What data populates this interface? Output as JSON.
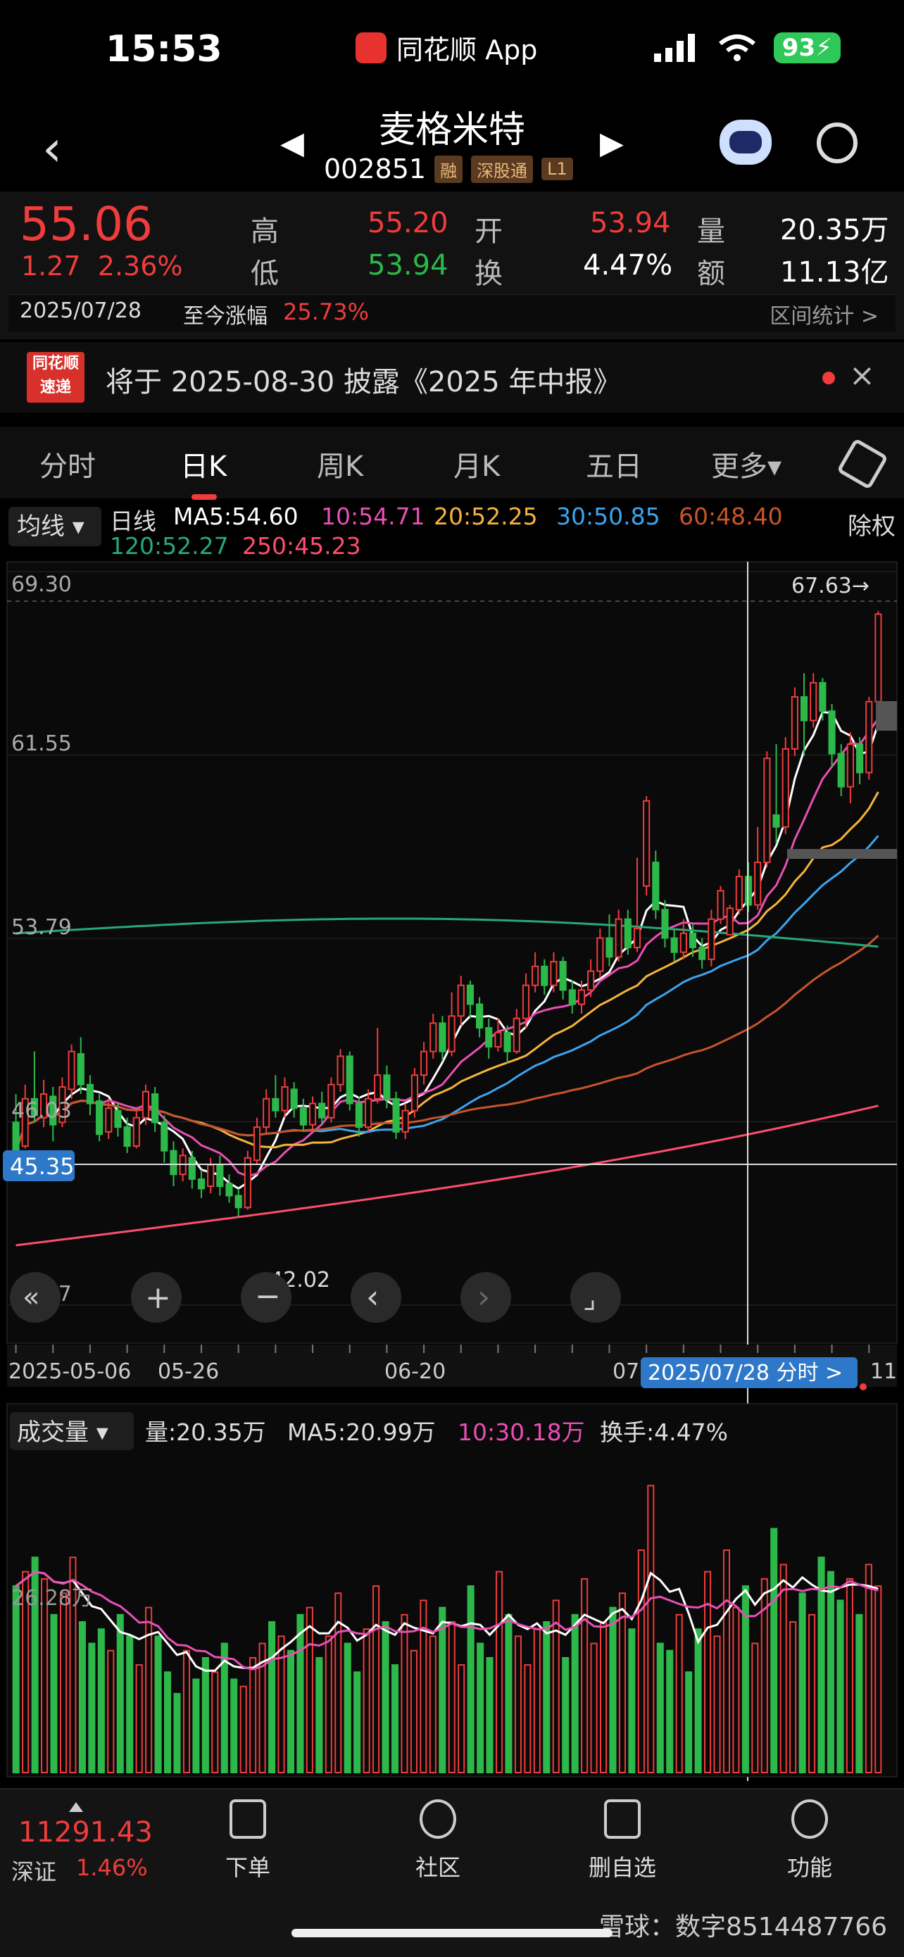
{
  "status": {
    "time": "15:53",
    "app_name": "同花顺 App",
    "battery": "93"
  },
  "header": {
    "title": "麦格米特",
    "code": "002851",
    "tags": [
      "融",
      "深股通",
      "L1"
    ]
  },
  "quote": {
    "price": "55.06",
    "change_abs": "1.27",
    "change_pct": "2.36%",
    "high_label": "高",
    "high": "55.20",
    "open_label": "开",
    "open": "53.94",
    "volume_label": "量",
    "volume": "20.35万",
    "low_label": "低",
    "low": "53.94",
    "turnover_label": "换",
    "turnover": "4.47%",
    "amount_label": "额",
    "amount": "11.13亿",
    "date": "2025/07/28",
    "to_now_label": "至今涨幅",
    "to_now_value": "25.73%",
    "range_stats": "区间统计 >"
  },
  "news": {
    "badge_top": "同花顺",
    "badge_bottom": "速递",
    "text": "将于 2025-08-30 披露《2025 年中报》"
  },
  "tabs": [
    "分时",
    "日K",
    "周K",
    "月K",
    "五日",
    "更多▾"
  ],
  "ma_legend": {
    "select": "均线 ▾",
    "series_label": "日线",
    "ma5": "MA5:54.60",
    "ma10": "10:54.71",
    "ma20": "20:52.25",
    "ma30": "30:50.85",
    "ma60": "60:48.40",
    "ma120": "120:52.27",
    "ma250": "250:45.23",
    "fuquan": "除权"
  },
  "chart_data": {
    "type": "candlestick",
    "y_labels": [
      "69.30",
      "61.55",
      "53.79",
      "46.03",
      "38.27"
    ],
    "ylim": [
      38.27,
      69.3
    ],
    "cursor_price": "45.35",
    "max_marker": "67.63→",
    "min_marker": "←42.02",
    "x_labels": [
      "2025-05-06",
      "05-26",
      "06-20",
      "07",
      "11"
    ],
    "cursor_date": "2025/07/28 分时 >",
    "candles": [
      {
        "o": 46.0,
        "c": 44.8,
        "h": 47.2,
        "l": 44.6
      },
      {
        "o": 45.0,
        "c": 47.0,
        "h": 47.6,
        "l": 44.9
      },
      {
        "o": 47.0,
        "c": 46.3,
        "h": 49.0,
        "l": 46.0
      },
      {
        "o": 46.2,
        "c": 47.2,
        "h": 47.8,
        "l": 45.8
      },
      {
        "o": 47.1,
        "c": 45.9,
        "h": 47.5,
        "l": 45.2
      },
      {
        "o": 46.0,
        "c": 47.5,
        "h": 47.9,
        "l": 45.8
      },
      {
        "o": 47.4,
        "c": 49.0,
        "h": 49.3,
        "l": 47.0
      },
      {
        "o": 48.9,
        "c": 47.6,
        "h": 49.6,
        "l": 47.2
      },
      {
        "o": 47.6,
        "c": 46.8,
        "h": 48.0,
        "l": 46.3
      },
      {
        "o": 46.9,
        "c": 45.5,
        "h": 47.2,
        "l": 45.2
      },
      {
        "o": 45.6,
        "c": 46.6,
        "h": 47.0,
        "l": 45.3
      },
      {
        "o": 46.5,
        "c": 45.8,
        "h": 46.8,
        "l": 45.4
      },
      {
        "o": 45.8,
        "c": 45.0,
        "h": 46.2,
        "l": 44.7
      },
      {
        "o": 45.0,
        "c": 46.2,
        "h": 46.5,
        "l": 44.9
      },
      {
        "o": 46.2,
        "c": 47.3,
        "h": 47.6,
        "l": 45.9
      },
      {
        "o": 47.2,
        "c": 46.0,
        "h": 47.5,
        "l": 45.6
      },
      {
        "o": 46.0,
        "c": 44.8,
        "h": 46.3,
        "l": 44.3
      },
      {
        "o": 44.8,
        "c": 43.8,
        "h": 45.2,
        "l": 43.3
      },
      {
        "o": 43.8,
        "c": 44.6,
        "h": 44.9,
        "l": 43.5
      },
      {
        "o": 44.5,
        "c": 43.6,
        "h": 44.8,
        "l": 43.2
      },
      {
        "o": 43.6,
        "c": 43.2,
        "h": 44.0,
        "l": 42.8
      },
      {
        "o": 43.3,
        "c": 44.2,
        "h": 44.5,
        "l": 43.0
      },
      {
        "o": 44.2,
        "c": 43.3,
        "h": 44.6,
        "l": 42.9
      },
      {
        "o": 43.4,
        "c": 42.9,
        "h": 43.8,
        "l": 42.6
      },
      {
        "o": 42.9,
        "c": 42.4,
        "h": 43.2,
        "l": 42.02
      },
      {
        "o": 42.4,
        "c": 44.5,
        "h": 44.8,
        "l": 42.3
      },
      {
        "o": 44.4,
        "c": 45.8,
        "h": 46.2,
        "l": 44.2
      },
      {
        "o": 45.8,
        "c": 47.0,
        "h": 47.4,
        "l": 45.5
      },
      {
        "o": 47.0,
        "c": 46.5,
        "h": 48.0,
        "l": 46.2
      },
      {
        "o": 46.5,
        "c": 47.5,
        "h": 47.9,
        "l": 46.2
      },
      {
        "o": 47.4,
        "c": 46.6,
        "h": 47.7,
        "l": 46.2
      },
      {
        "o": 46.6,
        "c": 45.9,
        "h": 47.0,
        "l": 45.6
      },
      {
        "o": 45.9,
        "c": 46.8,
        "h": 47.1,
        "l": 45.6
      },
      {
        "o": 46.8,
        "c": 46.2,
        "h": 47.3,
        "l": 45.9
      },
      {
        "o": 46.2,
        "c": 47.6,
        "h": 47.9,
        "l": 46.0
      },
      {
        "o": 47.6,
        "c": 48.8,
        "h": 49.1,
        "l": 47.3
      },
      {
        "o": 48.8,
        "c": 46.8,
        "h": 49.0,
        "l": 46.5
      },
      {
        "o": 46.8,
        "c": 45.8,
        "h": 47.1,
        "l": 45.4
      },
      {
        "o": 45.8,
        "c": 47.0,
        "h": 47.4,
        "l": 45.6
      },
      {
        "o": 47.0,
        "c": 48.0,
        "h": 50.0,
        "l": 46.8
      },
      {
        "o": 48.0,
        "c": 47.0,
        "h": 48.4,
        "l": 46.6
      },
      {
        "o": 47.0,
        "c": 45.6,
        "h": 47.3,
        "l": 45.3
      },
      {
        "o": 45.6,
        "c": 46.5,
        "h": 46.8,
        "l": 45.3
      },
      {
        "o": 46.5,
        "c": 48.0,
        "h": 48.3,
        "l": 46.2
      },
      {
        "o": 48.0,
        "c": 49.0,
        "h": 49.4,
        "l": 47.6
      },
      {
        "o": 49.0,
        "c": 50.2,
        "h": 50.6,
        "l": 48.7
      },
      {
        "o": 50.2,
        "c": 49.0,
        "h": 50.5,
        "l": 48.6
      },
      {
        "o": 49.0,
        "c": 50.5,
        "h": 51.5,
        "l": 48.8
      },
      {
        "o": 50.5,
        "c": 51.8,
        "h": 52.2,
        "l": 50.1
      },
      {
        "o": 51.8,
        "c": 51.0,
        "h": 52.0,
        "l": 50.4
      },
      {
        "o": 51.0,
        "c": 50.0,
        "h": 51.3,
        "l": 49.6
      },
      {
        "o": 50.0,
        "c": 49.2,
        "h": 50.4,
        "l": 48.7
      },
      {
        "o": 49.2,
        "c": 49.8,
        "h": 50.4,
        "l": 49.0
      },
      {
        "o": 49.8,
        "c": 49.0,
        "h": 50.1,
        "l": 48.5
      },
      {
        "o": 49.0,
        "c": 50.4,
        "h": 50.8,
        "l": 48.9
      },
      {
        "o": 50.4,
        "c": 51.8,
        "h": 52.3,
        "l": 50.0
      },
      {
        "o": 51.8,
        "c": 52.6,
        "h": 53.2,
        "l": 51.5
      },
      {
        "o": 52.6,
        "c": 51.8,
        "h": 52.9,
        "l": 51.4
      },
      {
        "o": 51.8,
        "c": 52.8,
        "h": 53.2,
        "l": 51.5
      },
      {
        "o": 52.8,
        "c": 51.6,
        "h": 53.0,
        "l": 51.2
      },
      {
        "o": 51.6,
        "c": 51.0,
        "h": 52.0,
        "l": 50.6
      },
      {
        "o": 51.0,
        "c": 51.6,
        "h": 52.0,
        "l": 50.6
      },
      {
        "o": 51.6,
        "c": 52.4,
        "h": 52.9,
        "l": 51.3
      },
      {
        "o": 52.4,
        "c": 53.8,
        "h": 54.2,
        "l": 52.1
      },
      {
        "o": 53.8,
        "c": 53.0,
        "h": 54.8,
        "l": 52.6
      },
      {
        "o": 53.0,
        "c": 54.6,
        "h": 55.0,
        "l": 52.8
      },
      {
        "o": 54.6,
        "c": 53.4,
        "h": 55.0,
        "l": 53.1
      },
      {
        "o": 53.4,
        "c": 54.2,
        "h": 57.2,
        "l": 53.2
      },
      {
        "o": 56.0,
        "c": 59.6,
        "h": 59.8,
        "l": 55.6
      },
      {
        "o": 57.0,
        "c": 55.0,
        "h": 57.5,
        "l": 54.6
      },
      {
        "o": 55.0,
        "c": 53.8,
        "h": 55.4,
        "l": 53.4
      },
      {
        "o": 53.8,
        "c": 53.2,
        "h": 54.2,
        "l": 52.8
      },
      {
        "o": 53.2,
        "c": 54.0,
        "h": 54.6,
        "l": 52.9
      },
      {
        "o": 54.0,
        "c": 53.4,
        "h": 54.4,
        "l": 53.0
      },
      {
        "o": 53.4,
        "c": 52.9,
        "h": 53.8,
        "l": 52.5
      },
      {
        "o": 52.9,
        "c": 54.6,
        "h": 55.0,
        "l": 52.6
      },
      {
        "o": 54.6,
        "c": 55.8,
        "h": 56.0,
        "l": 54.4
      },
      {
        "o": 53.94,
        "c": 55.06,
        "h": 55.2,
        "l": 53.94
      },
      {
        "o": 55.0,
        "c": 56.4,
        "h": 56.7,
        "l": 54.8
      },
      {
        "o": 56.4,
        "c": 55.2,
        "h": 57.0,
        "l": 54.9
      },
      {
        "o": 55.2,
        "c": 57.0,
        "h": 58.5,
        "l": 55.0
      },
      {
        "o": 57.0,
        "c": 61.4,
        "h": 61.7,
        "l": 56.8
      },
      {
        "o": 59.0,
        "c": 58.5,
        "h": 62.0,
        "l": 57.8
      },
      {
        "o": 58.5,
        "c": 61.8,
        "h": 62.3,
        "l": 58.2
      },
      {
        "o": 61.8,
        "c": 64.0,
        "h": 64.4,
        "l": 61.5
      },
      {
        "o": 64.0,
        "c": 63.0,
        "h": 65.0,
        "l": 61.5
      },
      {
        "o": 63.0,
        "c": 64.6,
        "h": 65.0,
        "l": 62.7
      },
      {
        "o": 64.6,
        "c": 63.4,
        "h": 64.8,
        "l": 63.0
      },
      {
        "o": 63.4,
        "c": 61.6,
        "h": 63.7,
        "l": 61.0
      },
      {
        "o": 61.6,
        "c": 60.2,
        "h": 62.0,
        "l": 59.8
      },
      {
        "o": 60.2,
        "c": 62.0,
        "h": 62.5,
        "l": 59.5
      },
      {
        "o": 62.0,
        "c": 60.8,
        "h": 62.3,
        "l": 60.3
      },
      {
        "o": 60.8,
        "c": 63.8,
        "h": 64.0,
        "l": 60.5
      },
      {
        "o": 63.8,
        "c": 67.5,
        "h": 67.63,
        "l": 63.5
      }
    ],
    "volume": {
      "select": "成交量 ▾",
      "legend_vol": "量:20.35万",
      "legend_ma5": "MA5:20.99万",
      "legend_ma10": "10:30.18万",
      "legend_turnover": "换手:4.47%",
      "y_label": "26.28万",
      "values": [
        26,
        28,
        30,
        27,
        22,
        25,
        30,
        21,
        18,
        20,
        17,
        22,
        19,
        15,
        23,
        19,
        14,
        11,
        17,
        13,
        16,
        14,
        18,
        13,
        12,
        16,
        18,
        21,
        19,
        17,
        22,
        23,
        16,
        19,
        25,
        18,
        14,
        20,
        26,
        21,
        15,
        22,
        17,
        24,
        19,
        23,
        21,
        15,
        26,
        18,
        16,
        28,
        22,
        19,
        15,
        20,
        21,
        24,
        16,
        22,
        27,
        18,
        21,
        23,
        25,
        20,
        31,
        40,
        18,
        17,
        22,
        14,
        20,
        28,
        19,
        31,
        23,
        26,
        18,
        27,
        34,
        29,
        21,
        25,
        22,
        30,
        28,
        24,
        27,
        22,
        29,
        26
      ]
    }
  },
  "chart_controls": [
    "«",
    "+",
    "−",
    "‹",
    "›",
    "⌟"
  ],
  "bottom_nav": {
    "index_value": "11291.43",
    "index_name": "深证",
    "index_pct": "1.46%",
    "items": [
      "下单",
      "社区",
      "删自选",
      "功能"
    ]
  },
  "watermark": "雪球：数字8514487766",
  "colors": {
    "up": "#f03c3c",
    "down": "#2db84a",
    "ma5": "#ffffff",
    "ma10": "#e84fb4",
    "ma20": "#f5b33c",
    "ma30": "#3ba5f0",
    "ma60": "#c8542a",
    "ma120": "#28a878",
    "ma250": "#ff4d6d"
  }
}
